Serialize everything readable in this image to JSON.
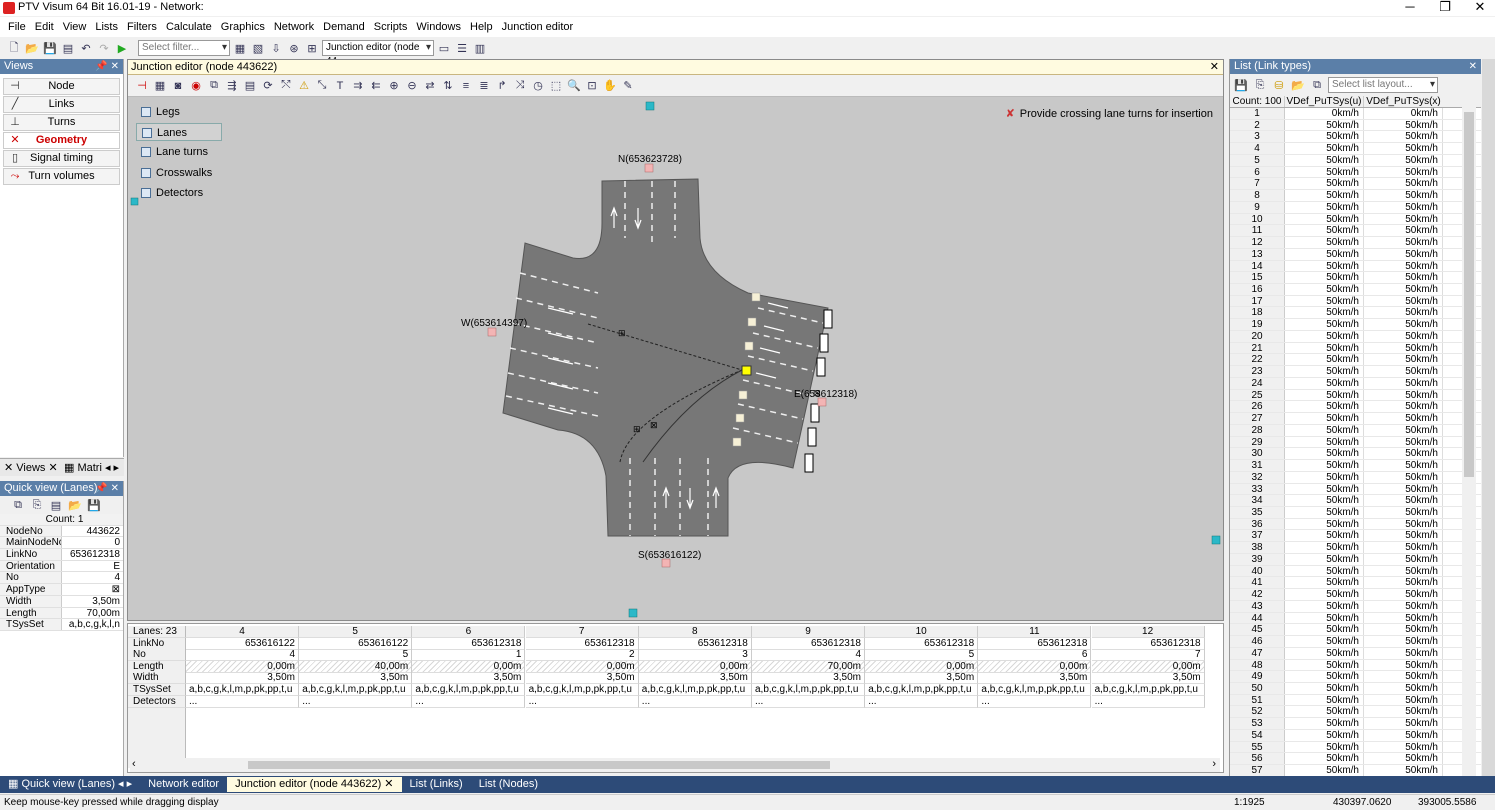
{
  "window": {
    "title": "PTV Visum 64 Bit 16.01-19 - Network:"
  },
  "menu": [
    "File",
    "Edit",
    "View",
    "Lists",
    "Filters",
    "Calculate",
    "Graphics",
    "Network",
    "Demand",
    "Scripts",
    "Windows",
    "Help",
    "Junction editor"
  ],
  "toolbar": {
    "filter_placeholder": "Select filter...",
    "junction_select": "Junction editor (node 44"
  },
  "views": {
    "title": "Views",
    "items": [
      {
        "label": "Node",
        "icon": "node-icon"
      },
      {
        "label": "Links",
        "icon": "links-icon"
      },
      {
        "label": "Turns",
        "icon": "turns-icon"
      },
      {
        "label": "Geometry",
        "icon": "geometry-icon",
        "active": true
      },
      {
        "label": "Signal timing",
        "icon": "signal-timing-icon"
      },
      {
        "label": "Turn volumes",
        "icon": "turn-volumes-icon"
      }
    ],
    "tabs": [
      "Views",
      "Matri"
    ]
  },
  "quickview": {
    "title": "Quick view (Lanes)",
    "count": "Count: 1",
    "rows": [
      {
        "k": "NodeNo",
        "v": "443622"
      },
      {
        "k": "MainNodeNo",
        "v": "0"
      },
      {
        "k": "LinkNo",
        "v": "653612318"
      },
      {
        "k": "Orientation",
        "v": "E"
      },
      {
        "k": "No",
        "v": "4"
      },
      {
        "k": "AppType",
        "v": "⊠"
      },
      {
        "k": "Width",
        "v": "3,50m"
      },
      {
        "k": "Length",
        "v": "70,00m"
      },
      {
        "k": "TSysSet",
        "v": "a,b,c,g,k,l,n"
      }
    ]
  },
  "junction": {
    "title": "Junction editor (node 443622)",
    "layers": [
      "Legs",
      "Lanes",
      "Lane turns",
      "Crosswalks",
      "Detectors"
    ],
    "active_layer": "Lanes",
    "hint": "Provide crossing lane turns for insertion",
    "labels": {
      "north": "N(653623728)",
      "west": "W(653614397)",
      "east": "E(653612318)",
      "south": "S(653616122)"
    }
  },
  "lanes_grid": {
    "count": "Lanes: 23",
    "row_labels": [
      "LinkNo",
      "No",
      "Length",
      "Width",
      "TSysSet",
      "Detectors"
    ],
    "columns": [
      {
        "h": "4",
        "LinkNo": "653616122",
        "No": "4",
        "Length": "0,00m",
        "Width": "3,50m",
        "TSysSet": "a,b,c,g,k,l,m,p,pk,pp,t,u",
        "Detectors": "..."
      },
      {
        "h": "5",
        "LinkNo": "653616122",
        "No": "5",
        "Length": "40,00m",
        "Width": "3,50m",
        "TSysSet": "a,b,c,g,k,l,m,p,pk,pp,t,u",
        "Detectors": "..."
      },
      {
        "h": "6",
        "LinkNo": "653612318",
        "No": "1",
        "Length": "0,00m",
        "Width": "3,50m",
        "TSysSet": "a,b,c,g,k,l,m,p,pk,pp,t,u",
        "Detectors": "..."
      },
      {
        "h": "7",
        "LinkNo": "653612318",
        "No": "2",
        "Length": "0,00m",
        "Width": "3,50m",
        "TSysSet": "a,b,c,g,k,l,m,p,pk,pp,t,u",
        "Detectors": "..."
      },
      {
        "h": "8",
        "LinkNo": "653612318",
        "No": "3",
        "Length": "0,00m",
        "Width": "3,50m",
        "TSysSet": "a,b,c,g,k,l,m,p,pk,pp,t,u",
        "Detectors": "..."
      },
      {
        "h": "9",
        "LinkNo": "653612318",
        "No": "4",
        "Length": "70,00m",
        "Width": "3,50m",
        "TSysSet": "a,b,c,g,k,l,m,p,pk,pp,t,u",
        "Detectors": "..."
      },
      {
        "h": "10",
        "LinkNo": "653612318",
        "No": "5",
        "Length": "0,00m",
        "Width": "3,50m",
        "TSysSet": "a,b,c,g,k,l,m,p,pk,pp,t,u",
        "Detectors": "..."
      },
      {
        "h": "11",
        "LinkNo": "653612318",
        "No": "6",
        "Length": "0,00m",
        "Width": "3,50m",
        "TSysSet": "a,b,c,g,k,l,m,p,pk,pp,t,u",
        "Detectors": "..."
      },
      {
        "h": "12",
        "LinkNo": "653612318",
        "No": "7",
        "Length": "0,00m",
        "Width": "3,50m",
        "TSysSet": "a,b,c,g,k,l,m,p,pk,pp,t,u",
        "Detectors": "..."
      }
    ]
  },
  "list": {
    "title": "List (Link types)",
    "layout_placeholder": "Select list layout...",
    "headers": [
      "Count: 100",
      "VDef_PuTSys(u)",
      "VDef_PuTSys(x)"
    ],
    "first_row": [
      "1",
      "0km/h",
      "0km/h"
    ],
    "default_value": "50km/h",
    "rows_visible": 57
  },
  "tabs": [
    "Quick view (Lanes)",
    "Network editor",
    "Junction editor (node 443622)",
    "List (Links)",
    "List (Nodes)"
  ],
  "active_tab": "Junction editor (node 443622)",
  "status": {
    "message": "Keep mouse-key pressed while dragging display",
    "scale": "1:1925",
    "x": "430397.0620",
    "y": "393005.5586"
  },
  "colors": {
    "panel_header": "#5b7fa8",
    "tabbar": "#2d4b78",
    "road": "#777777",
    "canvas": "#c8c8c8"
  }
}
